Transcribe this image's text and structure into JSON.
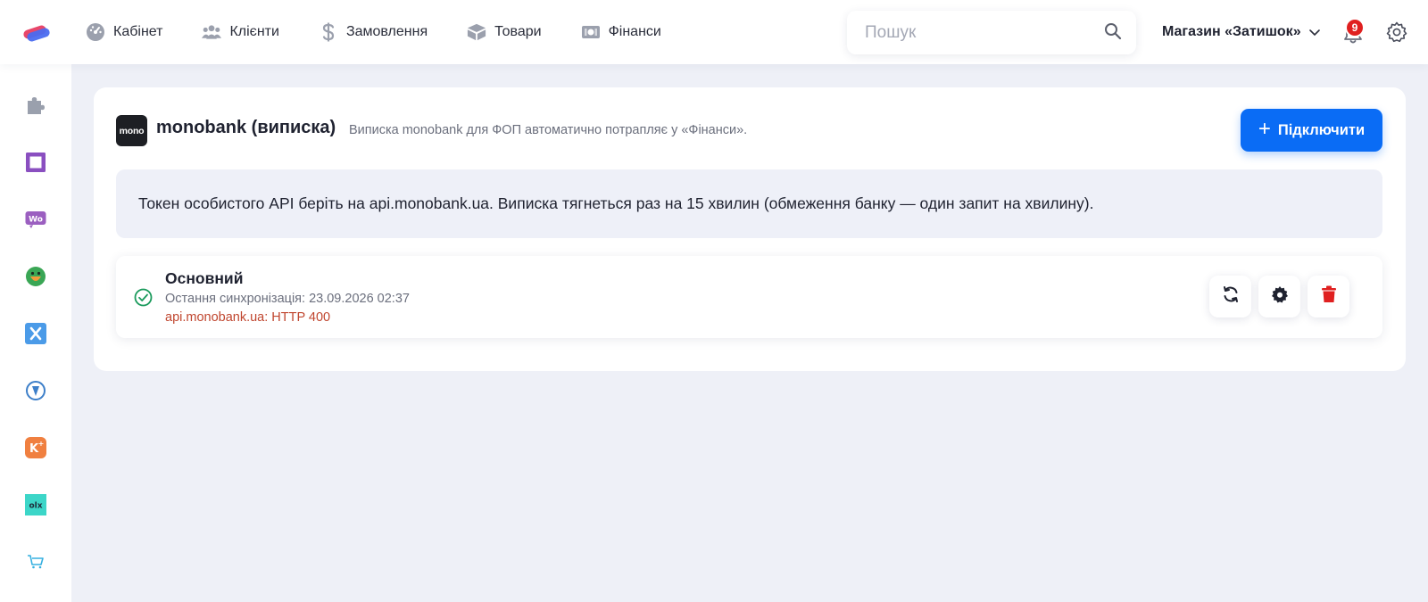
{
  "nav": {
    "items": [
      {
        "label": "Кабінет",
        "icon": "dashboard-icon"
      },
      {
        "label": "Клієнти",
        "icon": "users-icon"
      },
      {
        "label": "Замовлення",
        "icon": "dollar-icon"
      },
      {
        "label": "Товари",
        "icon": "box-icon"
      },
      {
        "label": "Фінанси",
        "icon": "money-icon"
      }
    ],
    "search_placeholder": "Пошук",
    "store_name": "Магазин «Затишок»",
    "notifications_count": "9"
  },
  "sidebar": {
    "items": [
      {
        "icon": "puzzle-icon",
        "color": "#9aa0ad"
      },
      {
        "icon": "square-app-icon",
        "color": "#8a4fc0"
      },
      {
        "icon": "woocommerce-icon",
        "color": "#9b5fc0"
      },
      {
        "icon": "smile-app-icon",
        "color": "#3aa655"
      },
      {
        "icon": "x-app-icon",
        "color": "#4b9be8"
      },
      {
        "icon": "pin-app-icon",
        "color": "#3d7fc9"
      },
      {
        "icon": "k-app-icon",
        "color": "#f08040"
      },
      {
        "icon": "olx-icon",
        "color": "#3cd6c8"
      },
      {
        "icon": "cart-icon",
        "color": "#36b0e0"
      }
    ]
  },
  "integration": {
    "logo_text": "mono",
    "title": "monobank (виписка)",
    "description": "Виписка monobank для ФОП автоматично потрапляє у «Фінанси».",
    "connect_label": "Підключити",
    "info_text": "Токен особистого API беріть на api.monobank.ua. Виписка тягнеться раз на 15 хвилин (обмеження банку — один запит на хвилину).",
    "account": {
      "name": "Основний",
      "last_sync": "Остання синхронізація: 23.09.2026 02:37",
      "error": "api.monobank.ua: HTTP 400"
    }
  },
  "colors": {
    "accent": "#0a6cf5",
    "danger": "#e02020",
    "success": "#1a9a5c",
    "error_text": "#c0462f"
  }
}
